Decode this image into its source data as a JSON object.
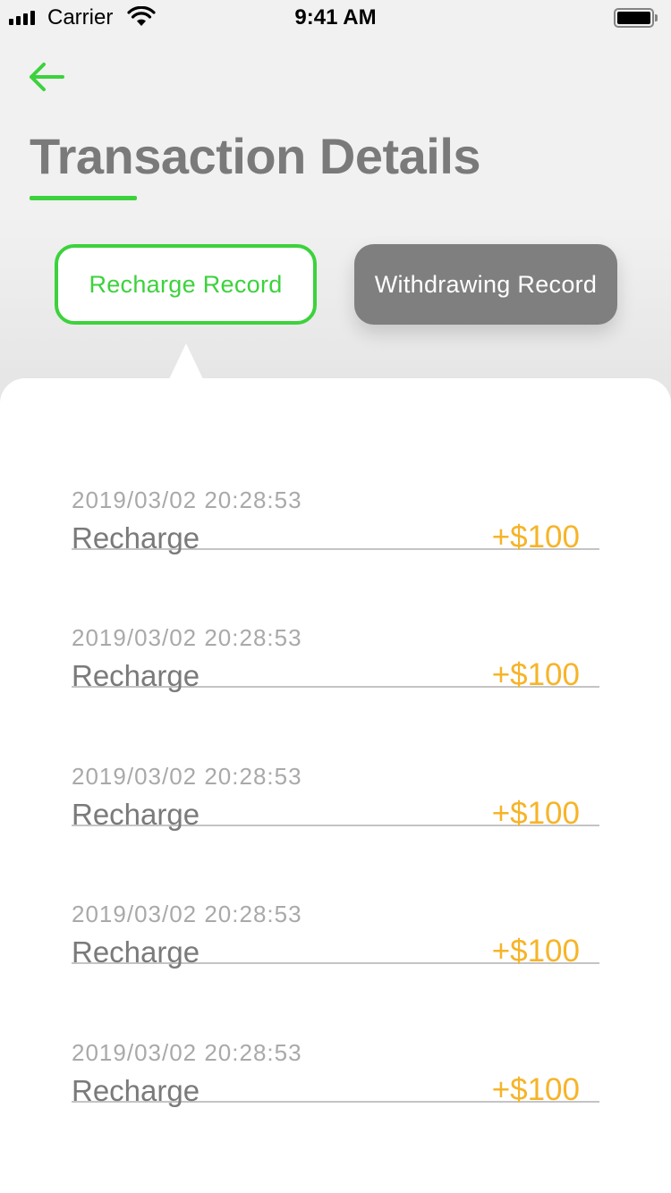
{
  "status_bar": {
    "carrier": "Carrier",
    "time": "9:41 AM"
  },
  "header": {
    "title": "Transaction Details"
  },
  "tabs": [
    {
      "label": "Recharge Record",
      "active": true
    },
    {
      "label": "Withdrawing Record",
      "active": false
    }
  ],
  "colors": {
    "accent": "#3cd23c",
    "amount": "#f6b429",
    "inactive_tab": "#7f7f7f"
  },
  "records": [
    {
      "timestamp": "2019/03/02 20:28:53",
      "type": "Recharge",
      "amount": "+$100"
    },
    {
      "timestamp": "2019/03/02 20:28:53",
      "type": "Recharge",
      "amount": "+$100"
    },
    {
      "timestamp": "2019/03/02 20:28:53",
      "type": "Recharge",
      "amount": "+$100"
    },
    {
      "timestamp": "2019/03/02 20:28:53",
      "type": "Recharge",
      "amount": "+$100"
    },
    {
      "timestamp": "2019/03/02 20:28:53",
      "type": "Recharge",
      "amount": "+$100"
    }
  ]
}
